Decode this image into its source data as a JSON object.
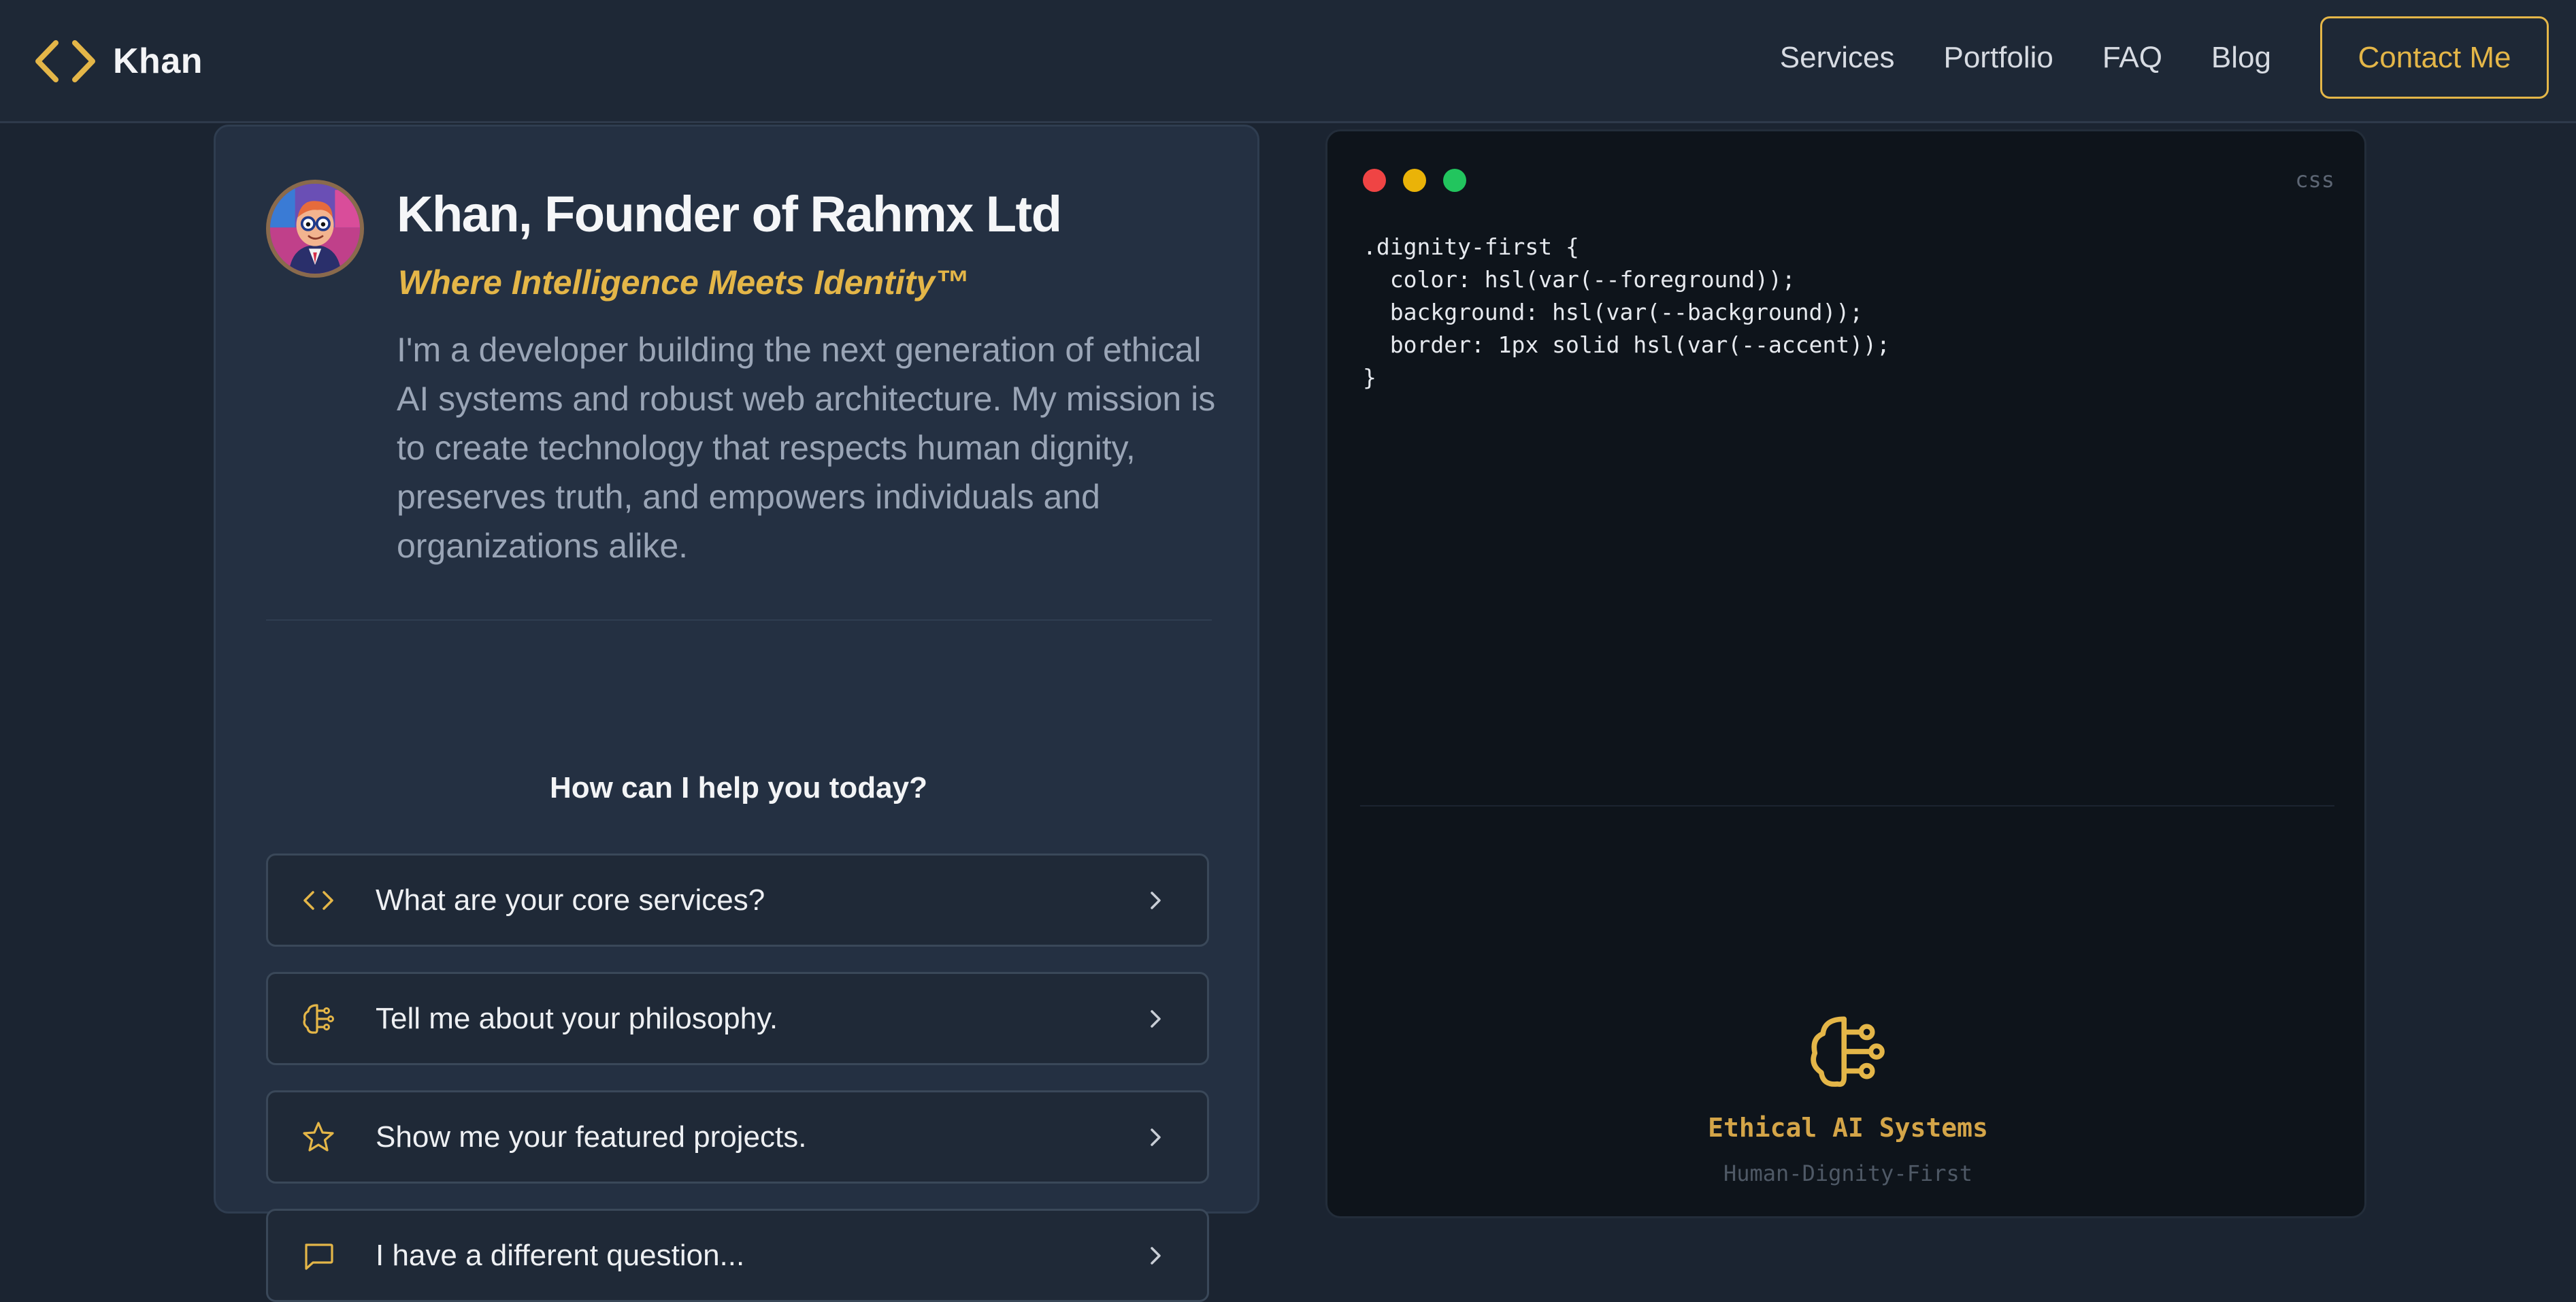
{
  "header": {
    "brand_name": "Khan",
    "nav": [
      "Services",
      "Portfolio",
      "FAQ",
      "Blog"
    ],
    "contact_label": "Contact Me"
  },
  "profile": {
    "title": "Khan, Founder of Rahmx Ltd",
    "tagline": "Where Intelligence Meets Identity™",
    "intro": "I'm a developer building the next generation of ethical AI systems and robust web architecture. My mission is to create technology that respects human dignity, preserves truth, and empowers individuals and organizations alike.",
    "avatar_icon": "avatar-illustration"
  },
  "help": {
    "heading": "How can I help you today?",
    "questions": [
      {
        "label": "What are your core services?",
        "icon": "code-icon"
      },
      {
        "label": "Tell me about your philosophy.",
        "icon": "brain-icon"
      },
      {
        "label": "Show me your featured projects.",
        "icon": "star-icon"
      },
      {
        "label": "I have a different question...",
        "icon": "message-icon"
      }
    ]
  },
  "editor": {
    "language": "css",
    "window_dots": [
      "#ef4444",
      "#eab308",
      "#22c55e"
    ],
    "code_lines": [
      ".dignity-first {",
      "  color: hsl(var(--foreground));",
      "  background: hsl(var(--background));",
      "  border: 1px solid hsl(var(--accent));",
      "}"
    ],
    "feature_title": "Ethical AI Systems",
    "feature_subtitle": "Human-Dignity-First",
    "feature_icon": "brain-icon"
  },
  "colors": {
    "accent": "#e4b648",
    "background": "#1b2431",
    "card": "#243042",
    "editor": "#0e141b"
  }
}
